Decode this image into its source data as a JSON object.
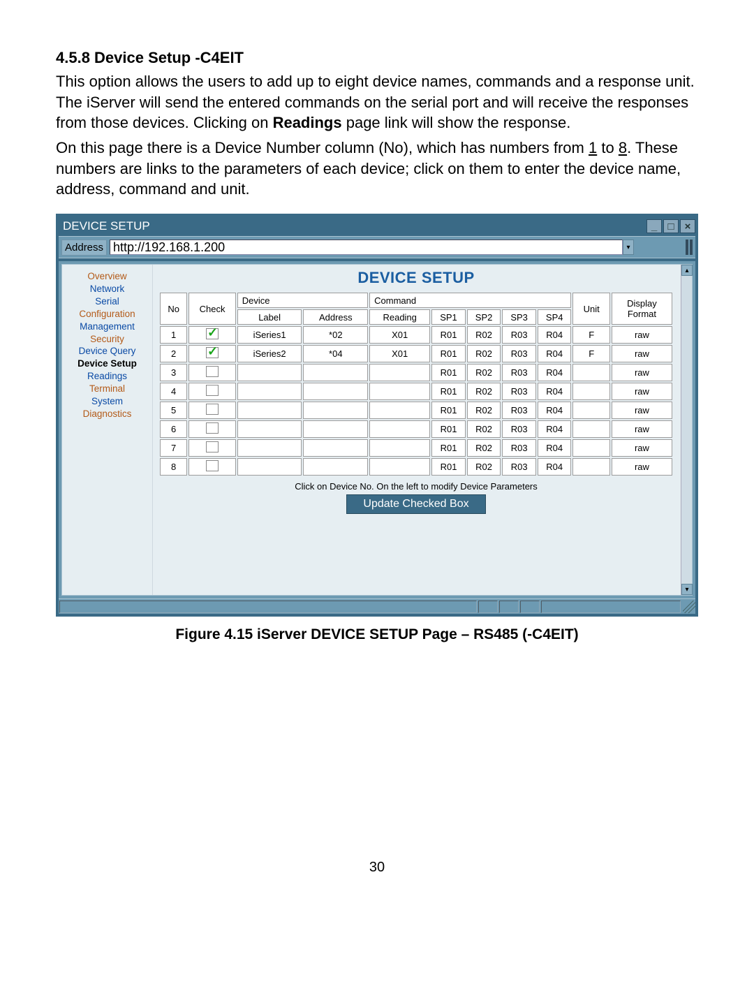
{
  "heading": "4.5.8  Device Setup -C4EIT",
  "para1_a": "This option allows the users to add up to eight device names, commands and a response unit.  The iServer will send the entered commands on the serial port and will receive the responses from those devices.  Clicking on ",
  "para1_bold": "Readings",
  "para1_b": " page link will show the response.",
  "para2_a": "On this page there is a Device Number column (No), which has numbers from ",
  "para2_u1": "1",
  "para2_mid": " to ",
  "para2_u2": "8",
  "para2_c": ". These numbers are links to the parameters of each device; click on them to enter the device name, address, command and unit.",
  "window_title": "DEVICE SETUP",
  "addr_label": "Address",
  "addr_value": "http://192.168.1.200",
  "sidebar": {
    "overview": "Overview",
    "network": "Network",
    "serial": "Serial",
    "configuration": "Configuration",
    "management": "Management",
    "security": "Security",
    "devicequery": "Device Query",
    "devicesetup": "Device Setup",
    "readings": "Readings",
    "terminal": "Terminal",
    "system": "System",
    "diagnostics": "Diagnostics"
  },
  "main_title": "DEVICE SETUP",
  "cols": {
    "no": "No",
    "check": "Check",
    "device": "Device",
    "label": "Label",
    "address": "Address",
    "command": "Command",
    "reading": "Reading",
    "sp1": "SP1",
    "sp2": "SP2",
    "sp3": "SP3",
    "sp4": "SP4",
    "unit": "Unit",
    "display": "Display Format"
  },
  "rows": [
    {
      "no": "1",
      "checked": true,
      "label": "iSeries1",
      "address": "*02",
      "reading": "X01",
      "sp1": "R01",
      "sp2": "R02",
      "sp3": "R03",
      "sp4": "R04",
      "unit": "F",
      "display": "raw"
    },
    {
      "no": "2",
      "checked": true,
      "label": "iSeries2",
      "address": "*04",
      "reading": "X01",
      "sp1": "R01",
      "sp2": "R02",
      "sp3": "R03",
      "sp4": "R04",
      "unit": "F",
      "display": "raw"
    },
    {
      "no": "3",
      "checked": false,
      "label": "",
      "address": "",
      "reading": "",
      "sp1": "R01",
      "sp2": "R02",
      "sp3": "R03",
      "sp4": "R04",
      "unit": "",
      "display": "raw"
    },
    {
      "no": "4",
      "checked": false,
      "label": "",
      "address": "",
      "reading": "",
      "sp1": "R01",
      "sp2": "R02",
      "sp3": "R03",
      "sp4": "R04",
      "unit": "",
      "display": "raw"
    },
    {
      "no": "5",
      "checked": false,
      "label": "",
      "address": "",
      "reading": "",
      "sp1": "R01",
      "sp2": "R02",
      "sp3": "R03",
      "sp4": "R04",
      "unit": "",
      "display": "raw"
    },
    {
      "no": "6",
      "checked": false,
      "label": "",
      "address": "",
      "reading": "",
      "sp1": "R01",
      "sp2": "R02",
      "sp3": "R03",
      "sp4": "R04",
      "unit": "",
      "display": "raw"
    },
    {
      "no": "7",
      "checked": false,
      "label": "",
      "address": "",
      "reading": "",
      "sp1": "R01",
      "sp2": "R02",
      "sp3": "R03",
      "sp4": "R04",
      "unit": "",
      "display": "raw"
    },
    {
      "no": "8",
      "checked": false,
      "label": "",
      "address": "",
      "reading": "",
      "sp1": "R01",
      "sp2": "R02",
      "sp3": "R03",
      "sp4": "R04",
      "unit": "",
      "display": "raw"
    }
  ],
  "bottom_note": "Click on Device No. On the left to modify Device Parameters",
  "update_btn": "Update Checked Box",
  "figure_caption": "Figure 4.15  iServer DEVICE SETUP Page – RS485 (-C4EIT)",
  "page_number": "30"
}
